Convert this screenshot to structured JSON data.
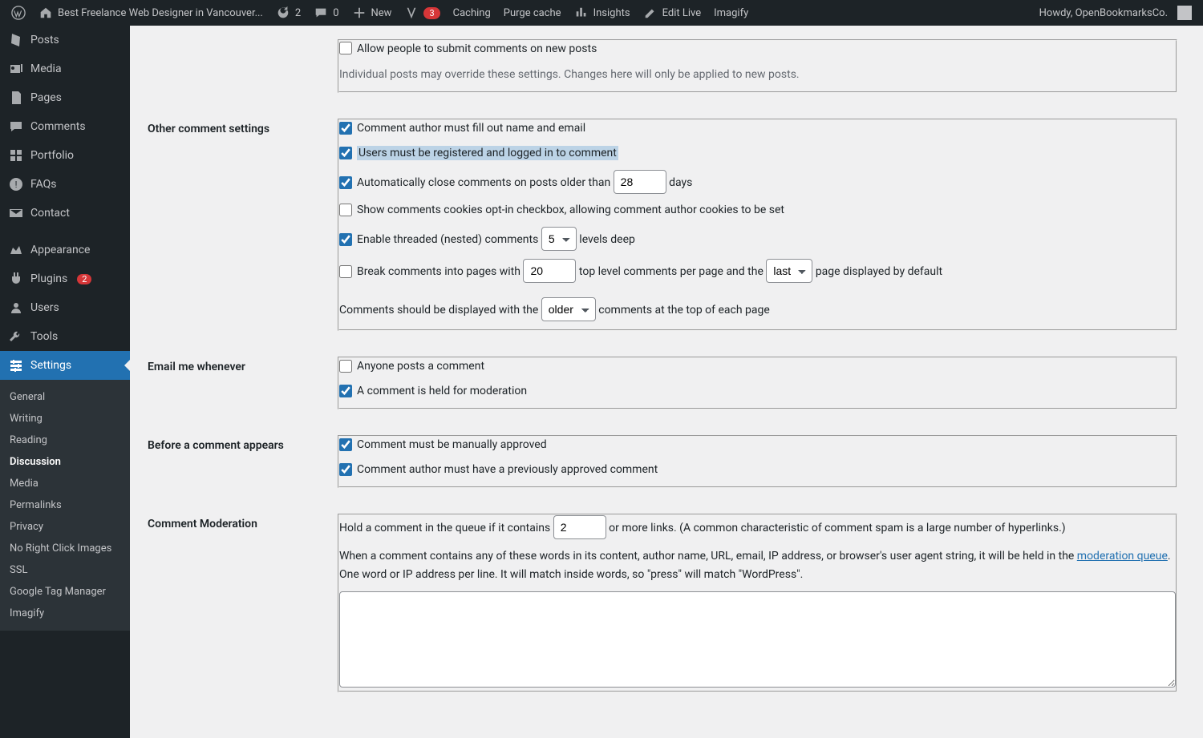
{
  "topbar": {
    "site_title": "Best Freelance Web Designer in Vancouver...",
    "updates_count": "2",
    "comments_count": "0",
    "new_label": "New",
    "yoast_count": "3",
    "caching": "Caching",
    "purge": "Purge cache",
    "insights": "Insights",
    "edit_live": "Edit Live",
    "imagify": "Imagify",
    "howdy": "Howdy, OpenBookmarksCo."
  },
  "sidebar": {
    "posts": "Posts",
    "media": "Media",
    "pages": "Pages",
    "comments": "Comments",
    "portfolio": "Portfolio",
    "faqs": "FAQs",
    "contact": "Contact",
    "appearance": "Appearance",
    "plugins": "Plugins",
    "plugins_badge": "2",
    "users": "Users",
    "tools": "Tools",
    "settings": "Settings",
    "sub": {
      "general": "General",
      "writing": "Writing",
      "reading": "Reading",
      "discussion": "Discussion",
      "media": "Media",
      "permalinks": "Permalinks",
      "privacy": "Privacy",
      "norightclick": "No Right Click Images",
      "ssl": "SSL",
      "gtm": "Google Tag Manager",
      "imagify": "Imagify"
    }
  },
  "settings": {
    "allow_submit": "Allow people to submit comments on new posts",
    "override_note": "Individual posts may override these settings. Changes here will only be applied to new posts.",
    "other_heading": "Other comment settings",
    "author_fill": "Comment author must fill out name and email",
    "registered": "Users must be registered and logged in to comment",
    "autoclose_pre": "Automatically close comments on posts older than ",
    "autoclose_val": "28",
    "autoclose_post": " days",
    "cookies_optin": "Show comments cookies opt-in checkbox, allowing comment author cookies to be set",
    "threaded_pre": "Enable threaded (nested) comments ",
    "threaded_val": "5",
    "threaded_post": " levels deep",
    "break_pre": "Break comments into pages with ",
    "break_val": "20",
    "break_mid1": " top level comments per page and the ",
    "break_page_val": "last",
    "break_mid2": " page displayed by default",
    "display_pre": "Comments should be displayed with the ",
    "display_val": "older",
    "display_post": " comments at the top of each page",
    "email_heading": "Email me whenever",
    "anyone_posts": "Anyone posts a comment",
    "held_moderation": "A comment is held for moderation",
    "before_heading": "Before a comment appears",
    "manual_approve": "Comment must be manually approved",
    "prev_approved": "Comment author must have a previously approved comment",
    "moderation_heading": "Comment Moderation",
    "hold_pre": "Hold a comment in the queue if it contains ",
    "hold_val": "2",
    "hold_post": " or more links. (A common characteristic of comment spam is a large number of hyperlinks.)",
    "when_text_1": "When a comment contains any of these words in its content, author name, URL, email, IP address, or browser's user agent string, it will be held in the ",
    "moderation_queue_link": "moderation queue",
    "when_text_2": ". One word or IP address per line. It will match inside words, so \"press\" will match \"WordPress\"."
  }
}
